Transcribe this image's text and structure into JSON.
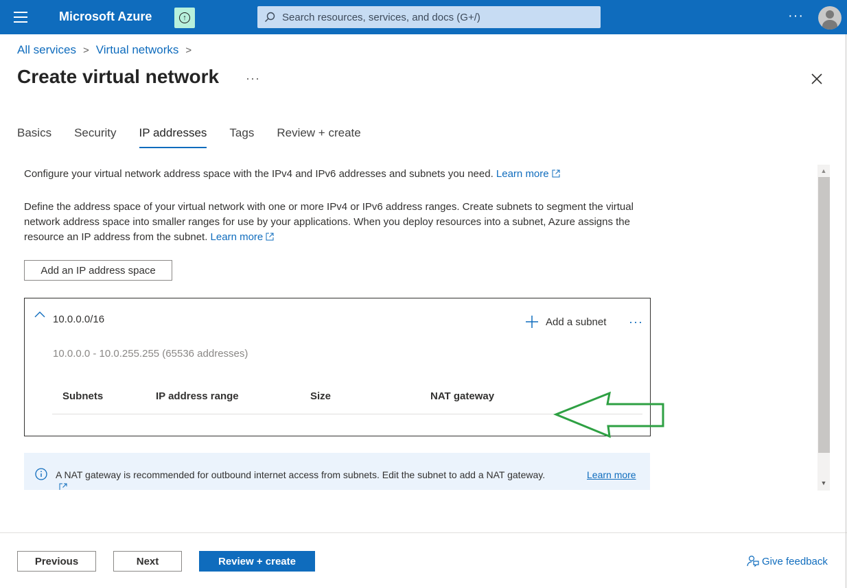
{
  "topbar": {
    "brand": "Microsoft Azure",
    "search_placeholder": "Search resources, services, and docs (G+/)",
    "more": "···",
    "accent": "#0f6cbd"
  },
  "breadcrumb": {
    "items": [
      "All services",
      "Virtual networks"
    ],
    "separator": ">"
  },
  "page": {
    "title": "Create virtual network",
    "more": "···"
  },
  "tabs": [
    {
      "label": "Basics",
      "active": false
    },
    {
      "label": "Security",
      "active": false
    },
    {
      "label": "IP addresses",
      "active": true
    },
    {
      "label": "Tags",
      "active": false
    },
    {
      "label": "Review + create",
      "active": false
    }
  ],
  "content": {
    "intro": "Configure your virtual network address space with the IPv4 and IPv6 addresses and subnets you need.",
    "intro_link": "Learn more",
    "description": "Define the address space of your virtual network with one or more IPv4 or IPv6 address ranges. Create subnets to segment the virtual network address space into smaller ranges for use by your applications. When you deploy resources into a subnet, Azure assigns the resource an IP address from the subnet.",
    "description_link": "Learn more",
    "add_space_label": "Add an IP address space"
  },
  "address_space": {
    "cidr": "10.0.0.0/16",
    "range": "10.0.0.0 - 10.0.255.255 (65536 addresses)",
    "add_subnet_label": "Add a subnet",
    "more": "···",
    "columns": [
      "Subnets",
      "IP address range",
      "Size",
      "NAT gateway"
    ]
  },
  "info": {
    "text": "A NAT gateway is recommended for outbound internet access from subnets. Edit the subnet to add a NAT gateway.",
    "link": "Learn more"
  },
  "footer": {
    "previous": "Previous",
    "next": "Next",
    "review_create": "Review + create",
    "feedback": "Give feedback"
  },
  "annotation": {
    "arrow_color": "#2ea043"
  }
}
